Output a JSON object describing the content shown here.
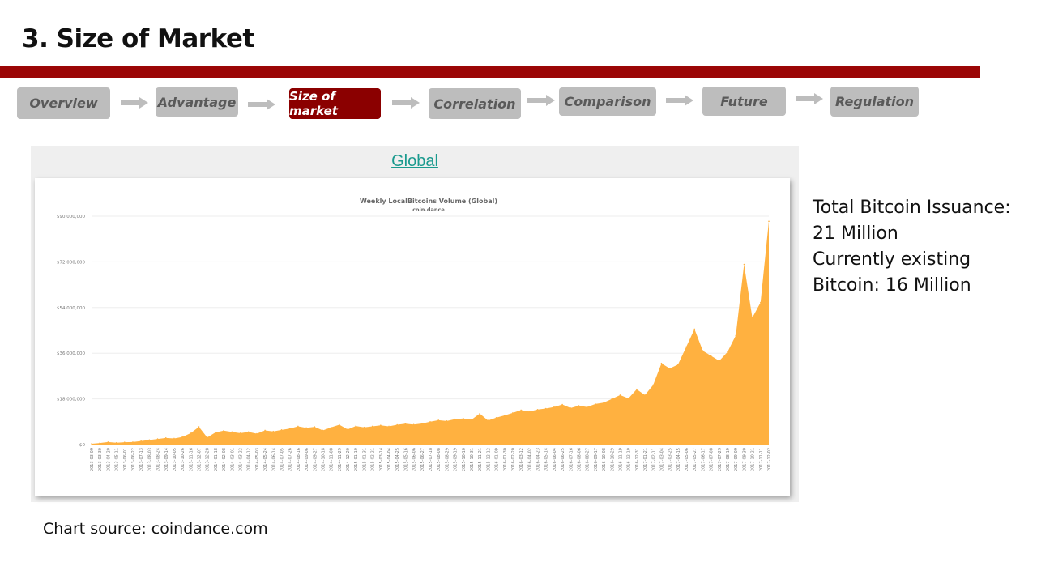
{
  "slide": {
    "title": "3. Size of Market",
    "accent_color": "#9b0606"
  },
  "nav": {
    "steps": [
      {
        "label": "Overview",
        "active": false
      },
      {
        "label": "Advantage",
        "active": false
      },
      {
        "label": "Size of market",
        "active": true
      },
      {
        "label": "Correlation",
        "active": false
      },
      {
        "label": "Comparison",
        "active": false
      },
      {
        "label": "Future",
        "active": false
      },
      {
        "label": "Regulation",
        "active": false
      }
    ],
    "arrow_icon": "right-arrow-icon",
    "active_color": "#8b0000",
    "inactive_color": "#bdbdbd"
  },
  "panel": {
    "link_label": "Global",
    "link_color": "#1a9a8e"
  },
  "side_info": {
    "lines": [
      "Total Bitcoin Issuance:",
      "21 Million",
      "Currently existing",
      "Bitcoin: 16 Million"
    ]
  },
  "source": {
    "text": "Chart source: coindance.com"
  },
  "chart_data": {
    "type": "area",
    "title": "Weekly LocalBitcoins Volume (Global)",
    "subtitle": "coin.dance",
    "xlabel": "",
    "ylabel": "",
    "ylim": [
      0,
      90000000
    ],
    "yticks": [
      0,
      18000000,
      36000000,
      54000000,
      72000000,
      90000000
    ],
    "ytick_labels": [
      "$0",
      "$18,000,000",
      "$36,000,000",
      "$54,000,000",
      "$72,000,000",
      "$90,000,000"
    ],
    "grid": true,
    "legend": "none",
    "fill_color": "#ffb140",
    "x": [
      "2013-03-09",
      "2013-03-30",
      "2013-04-20",
      "2013-05-11",
      "2013-06-01",
      "2013-06-22",
      "2013-07-13",
      "2013-08-03",
      "2013-08-24",
      "2013-09-14",
      "2013-10-05",
      "2013-10-26",
      "2013-11-16",
      "2013-12-07",
      "2013-12-28",
      "2014-01-18",
      "2014-02-08",
      "2014-03-01",
      "2014-03-22",
      "2014-04-12",
      "2014-05-03",
      "2014-05-24",
      "2014-06-14",
      "2014-07-05",
      "2014-07-26",
      "2014-08-16",
      "2014-09-06",
      "2014-09-27",
      "2014-10-18",
      "2014-11-08",
      "2014-11-29",
      "2014-12-20",
      "2015-01-10",
      "2015-01-31",
      "2015-02-21",
      "2015-03-14",
      "2015-04-04",
      "2015-04-25",
      "2015-05-16",
      "2015-06-06",
      "2015-06-27",
      "2015-07-18",
      "2015-08-08",
      "2015-08-29",
      "2015-09-19",
      "2015-10-10",
      "2015-10-31",
      "2015-11-21",
      "2015-12-12",
      "2016-01-09",
      "2016-01-30",
      "2016-02-20",
      "2016-03-12",
      "2016-04-02",
      "2016-04-23",
      "2016-05-14",
      "2016-06-04",
      "2016-06-25",
      "2016-07-16",
      "2016-08-06",
      "2016-08-27",
      "2016-09-17",
      "2016-10-08",
      "2016-10-29",
      "2016-11-19",
      "2016-12-10",
      "2016-12-31",
      "2017-01-21",
      "2017-02-11",
      "2017-03-04",
      "2017-03-25",
      "2017-04-15",
      "2017-05-06",
      "2017-05-27",
      "2017-06-17",
      "2017-07-08",
      "2017-07-29",
      "2017-08-19",
      "2017-09-09",
      "2017-09-30",
      "2017-10-21",
      "2017-11-11",
      "2017-12-02"
    ],
    "values": [
      300000,
      600000,
      1000000,
      700000,
      900000,
      1000000,
      1400000,
      1800000,
      2200000,
      2600000,
      2400000,
      3000000,
      4500000,
      7000000,
      2800000,
      4800000,
      5500000,
      5000000,
      4500000,
      5000000,
      4300000,
      5600000,
      5200000,
      5800000,
      6300000,
      7200000,
      6600000,
      7000000,
      5600000,
      6800000,
      7800000,
      6000000,
      7300000,
      6800000,
      7200000,
      7600000,
      7200000,
      7800000,
      8200000,
      7900000,
      8300000,
      9000000,
      9600000,
      9300000,
      10000000,
      10300000,
      9800000,
      12200000,
      9500000,
      10600000,
      11500000,
      12500000,
      13600000,
      13000000,
      13800000,
      14200000,
      14800000,
      15800000,
      14400000,
      15300000,
      14800000,
      16000000,
      16500000,
      18000000,
      19500000,
      18200000,
      21800000,
      19500000,
      23500000,
      32000000,
      30000000,
      31500000,
      38500000,
      45500000,
      37000000,
      35000000,
      33000000,
      36500000,
      43000000,
      71000000,
      50000000,
      56000000,
      88000000
    ]
  }
}
